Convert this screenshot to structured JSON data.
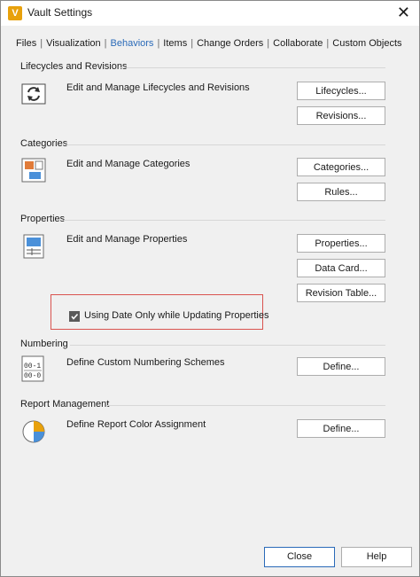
{
  "window": {
    "title": "Vault Settings",
    "app_icon_letter": "V"
  },
  "tabs": [
    {
      "label": "Files",
      "active": false
    },
    {
      "label": "Visualization",
      "active": false
    },
    {
      "label": "Behaviors",
      "active": true
    },
    {
      "label": "Items",
      "active": false
    },
    {
      "label": "Change Orders",
      "active": false
    },
    {
      "label": "Collaborate",
      "active": false
    },
    {
      "label": "Custom Objects",
      "active": false
    }
  ],
  "groups": {
    "lifecycles": {
      "title": "Lifecycles and Revisions",
      "description": "Edit and Manage Lifecycles and Revisions",
      "buttons": [
        "Lifecycles...",
        "Revisions..."
      ]
    },
    "categories": {
      "title": "Categories",
      "description": "Edit and Manage Categories",
      "buttons": [
        "Categories...",
        "Rules..."
      ]
    },
    "properties": {
      "title": "Properties",
      "description": "Edit and Manage Properties",
      "buttons": [
        "Properties...",
        "Data Card...",
        "Revision Table..."
      ],
      "checkbox": {
        "label": "Using Date Only while Updating Properties",
        "checked": true
      }
    },
    "numbering": {
      "title": "Numbering",
      "description": "Define Custom Numbering Schemes",
      "buttons": [
        "Define..."
      ]
    },
    "report": {
      "title": "Report Management",
      "description": "Define Report Color Assignment",
      "buttons": [
        "Define..."
      ]
    }
  },
  "footer": {
    "close_label": "Close",
    "help_label": "Help"
  },
  "colors": {
    "accent": "#2a6ab8",
    "highlight": "#d9534f",
    "app_icon": "#e8a10c"
  }
}
